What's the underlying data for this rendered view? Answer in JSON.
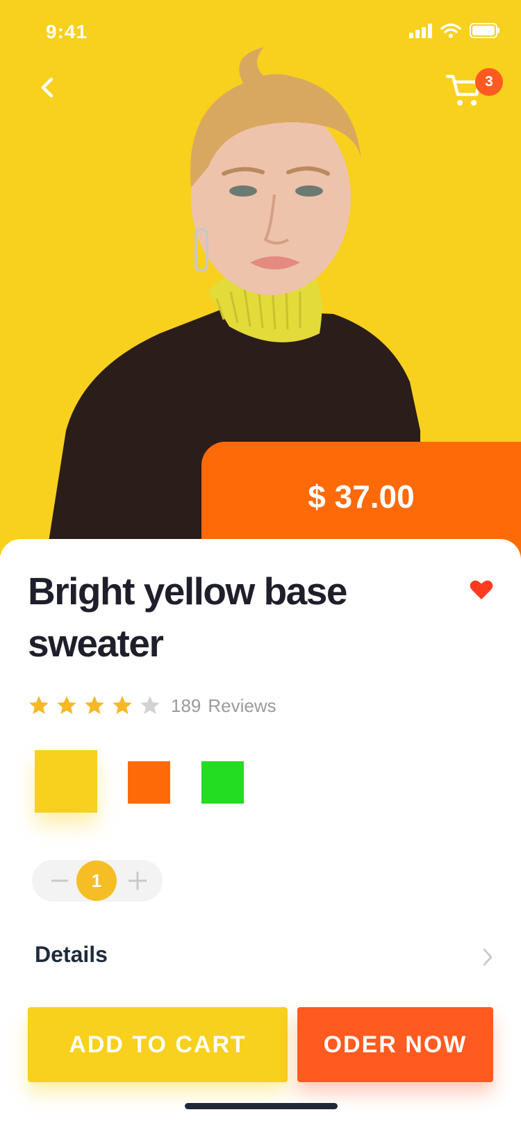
{
  "status_bar": {
    "time": "9:41"
  },
  "header": {
    "cart_count": "3"
  },
  "product": {
    "price": "$ 37.00",
    "title": "Bright yellow base sweater",
    "rating": 4,
    "rating_max": 5,
    "reviews_count": "189",
    "reviews_label": "Reviews",
    "favorite": true
  },
  "colors": {
    "brand_yellow": "#F8D01E",
    "brand_orange": "#FF6A08",
    "accent_red": "#FF3B1F",
    "swatches": [
      "#F8D01E",
      "#FF6A08",
      "#22DD22"
    ],
    "selected_swatch": 0
  },
  "quantity": {
    "value": "1"
  },
  "details": {
    "label": "Details"
  },
  "actions": {
    "add_to_cart": "ADD TO CART",
    "order_now": "ODER NOW"
  }
}
